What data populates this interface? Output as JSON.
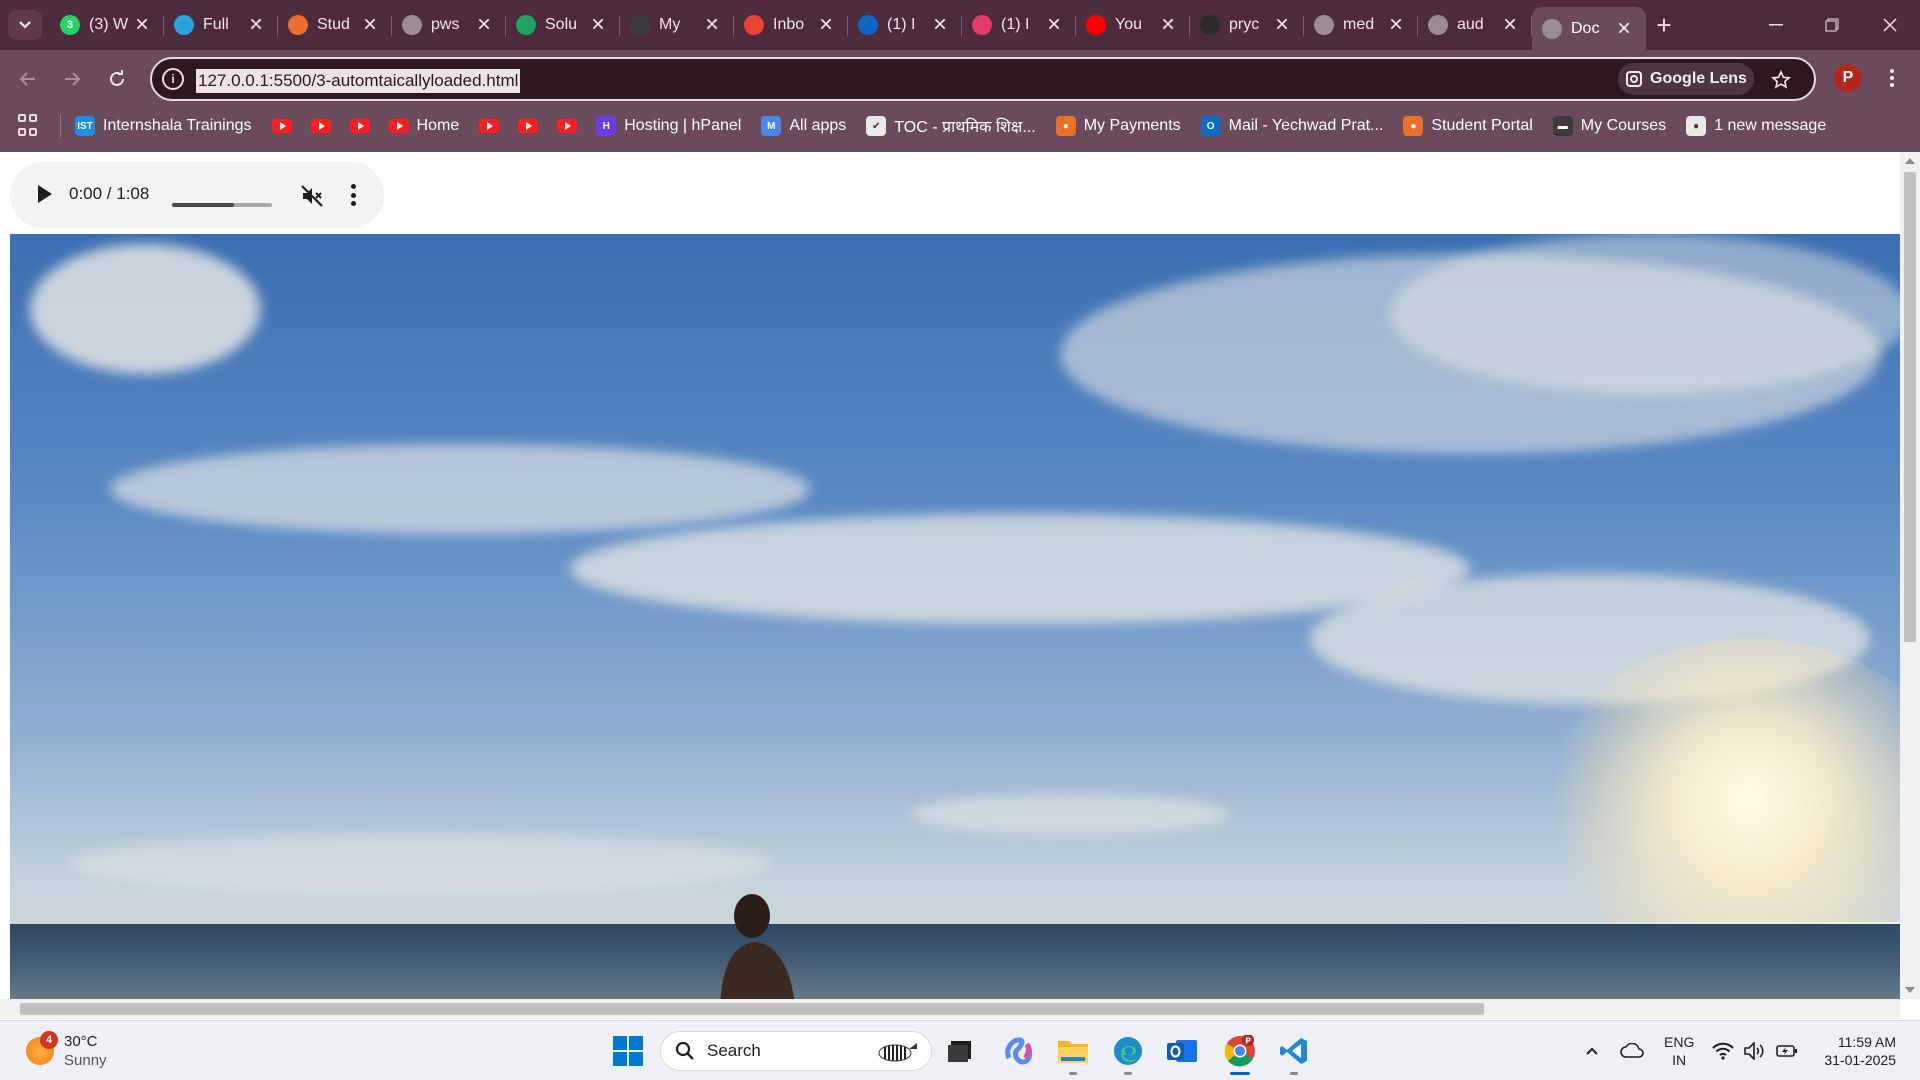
{
  "window": {
    "tabs": [
      {
        "title": "(3) W",
        "icon": "whatsapp-icon",
        "color": "#25d366",
        "badge": "3"
      },
      {
        "title": "Full",
        "icon": "telegram-icon",
        "color": "#2aa3e0"
      },
      {
        "title": "Stud",
        "icon": "student-icon",
        "color": "#e8702a"
      },
      {
        "title": "pws",
        "icon": "globe-icon",
        "color": "#9a8a93"
      },
      {
        "title": "Solu",
        "icon": "google-drive-icon",
        "color": "#1ea362"
      },
      {
        "title": "My",
        "icon": "courses-icon",
        "color": "#3c3c3c"
      },
      {
        "title": "Inbo",
        "icon": "gmail-icon",
        "color": "#ea4335"
      },
      {
        "title": "(1) I",
        "icon": "linkedin-icon",
        "color": "#0a66c2"
      },
      {
        "title": "(1) I",
        "icon": "threads-icon",
        "color": "#e23b6a"
      },
      {
        "title": "You",
        "icon": "youtube-icon",
        "color": "#ff0000"
      },
      {
        "title": "pryc",
        "icon": "github-icon",
        "color": "#2b2b2b"
      },
      {
        "title": "med",
        "icon": "globe-icon",
        "color": "#9a8a93"
      },
      {
        "title": "aud",
        "icon": "globe-icon",
        "color": "#9a8a93"
      },
      {
        "title": "Doc",
        "icon": "globe-icon",
        "color": "#9a8a93",
        "active": true
      }
    ]
  },
  "toolbar": {
    "url": "127.0.0.1:5500/3-automtaicallyloaded.html",
    "lens_label": "Google Lens",
    "profile_initial": "P"
  },
  "bookmarks": [
    {
      "label": "Internshala Trainings",
      "icon": "internshala-icon",
      "color": "#1d8de0",
      "glyph": "IST"
    },
    {
      "label": "",
      "icon": "youtube-icon"
    },
    {
      "label": "",
      "icon": "youtube-icon"
    },
    {
      "label": "",
      "icon": "youtube-icon"
    },
    {
      "label": "Home",
      "icon": "youtube-icon"
    },
    {
      "label": "",
      "icon": "youtube-icon"
    },
    {
      "label": "",
      "icon": "youtube-icon"
    },
    {
      "label": "",
      "icon": "youtube-icon"
    },
    {
      "label": "Hosting | hPanel",
      "icon": "hostinger-icon",
      "color": "#673de6",
      "glyph": "H"
    },
    {
      "label": "All apps",
      "icon": "all-apps-icon",
      "color": "#4a86e8",
      "glyph": "M"
    },
    {
      "label": "TOC - प्राथमिक शिक्ष...",
      "icon": "toc-icon",
      "color": "#e9e9e9",
      "glyph": "✔"
    },
    {
      "label": "My Payments",
      "icon": "payments-icon",
      "color": "#e8702a",
      "glyph": "●"
    },
    {
      "label": "Mail - Yechwad Prat...",
      "icon": "outlook-icon",
      "color": "#0f6cbd",
      "glyph": "O"
    },
    {
      "label": "Student Portal",
      "icon": "student-portal-icon",
      "color": "#e8702a",
      "glyph": "●"
    },
    {
      "label": "My Courses",
      "icon": "courses-icon",
      "color": "#3c3c3c",
      "glyph": "▬"
    },
    {
      "label": "1 new message",
      "icon": "globe-icon",
      "color": "#e9e9e9",
      "glyph": "●"
    }
  ],
  "audio": {
    "time": "0:00 / 1:08",
    "volume_level": 0.62,
    "muted": true
  },
  "taskbar": {
    "weather_temp": "30°C",
    "weather_cond": "Sunny",
    "weather_badge": "4",
    "search_placeholder": "Search",
    "lang_top": "ENG",
    "lang_bottom": "IN",
    "time": "11:59 AM",
    "date": "31-01-2025"
  },
  "colors": {
    "tabstrip": "#4d2b3c",
    "toolbar": "#6b4a5b",
    "accent": "#0067c0"
  }
}
